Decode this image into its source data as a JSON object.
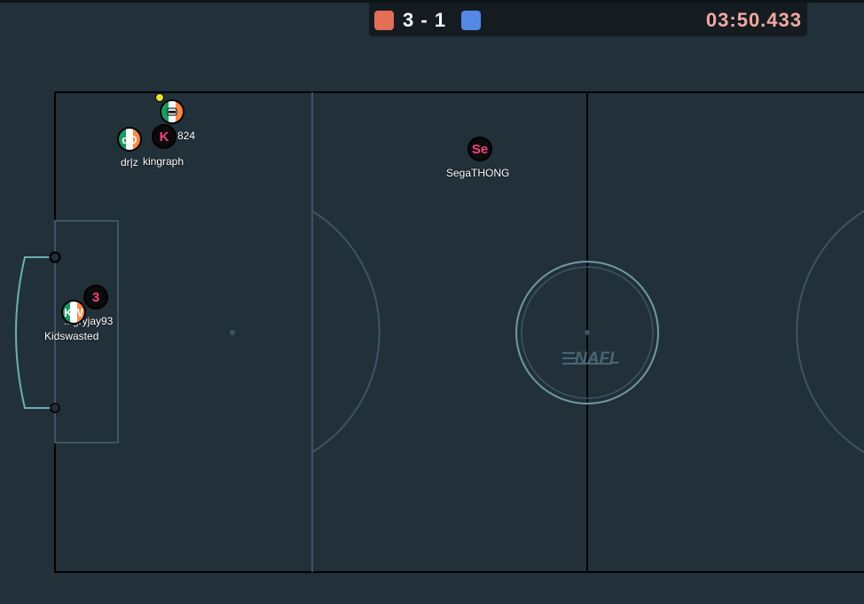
{
  "scoreboard": {
    "red_score": "3",
    "separator": "-",
    "blue_score": "1",
    "timer": "03:50.433",
    "red_color": "#e56e56",
    "blue_color": "#5689e5",
    "timer_color": "#f3a9a0"
  },
  "field": {
    "watermark": "NAFL",
    "line_color": "#000000",
    "markings_color": "#3d5563",
    "goal_color": "#6bb0b0"
  },
  "players": [
    {
      "nick": "...824",
      "avatar": "",
      "avatar_style": "flag",
      "avatar_icon": "robot-icon"
    },
    {
      "nick": "kingraph",
      "avatar": "K",
      "avatar_style": "dark",
      "avatar_color": "#ff3e87"
    },
    {
      "nick": "dr|z",
      "avatar": "dD",
      "avatar_style": "flag"
    },
    {
      "nick": "SegaTHONG",
      "avatar": "Se",
      "avatar_style": "dark",
      "avatar_color": "#ff3e87"
    },
    {
      "nick": "...gryjay93",
      "avatar": "3",
      "avatar_style": "dark",
      "avatar_color": "#ff3e87"
    },
    {
      "nick": "Kidswasted",
      "avatar": "KW",
      "avatar_style": "flag"
    }
  ]
}
